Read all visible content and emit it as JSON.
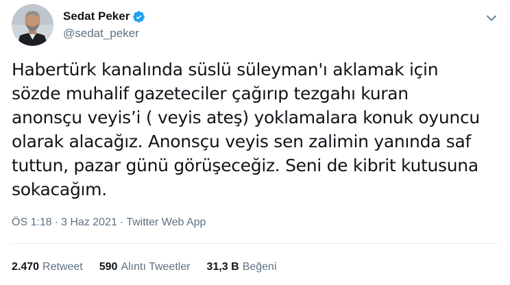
{
  "author": {
    "display_name": "Sedat Peker",
    "handle": "@sedat_peker",
    "verified": true
  },
  "tweet": {
    "text": "Habertürk kanalında süslü süleyman'ı aklamak için\nsözde muhalif gazeteciler çağırıp tezgahı kuran\nanonsçu veyis’i ( veyis ateş) yoklamalara konuk oyuncu\nolarak alacağız. Anonsçu veyis sen zalimin yanında saf\ntuttun, pazar günü görüşeceğiz. Seni de kibrit kutusuna\nsokacağım.",
    "time": "ÖS 1:18",
    "separator": "·",
    "date": "3 Haz 2021",
    "source": "Twitter Web App"
  },
  "stats": {
    "retweets": {
      "count": "2.470",
      "label": "Retweet"
    },
    "quotes": {
      "count": "590",
      "label": "Alıntı Tweetler"
    },
    "likes": {
      "count": "31,3 B",
      "label": "Beğeni"
    }
  },
  "icons": {
    "verified": "verified-badge-icon",
    "more": "more-options-icon"
  },
  "colors": {
    "accent": "#1da1f2",
    "secondary_text": "#5b7083",
    "primary_text": "#0f1419"
  }
}
